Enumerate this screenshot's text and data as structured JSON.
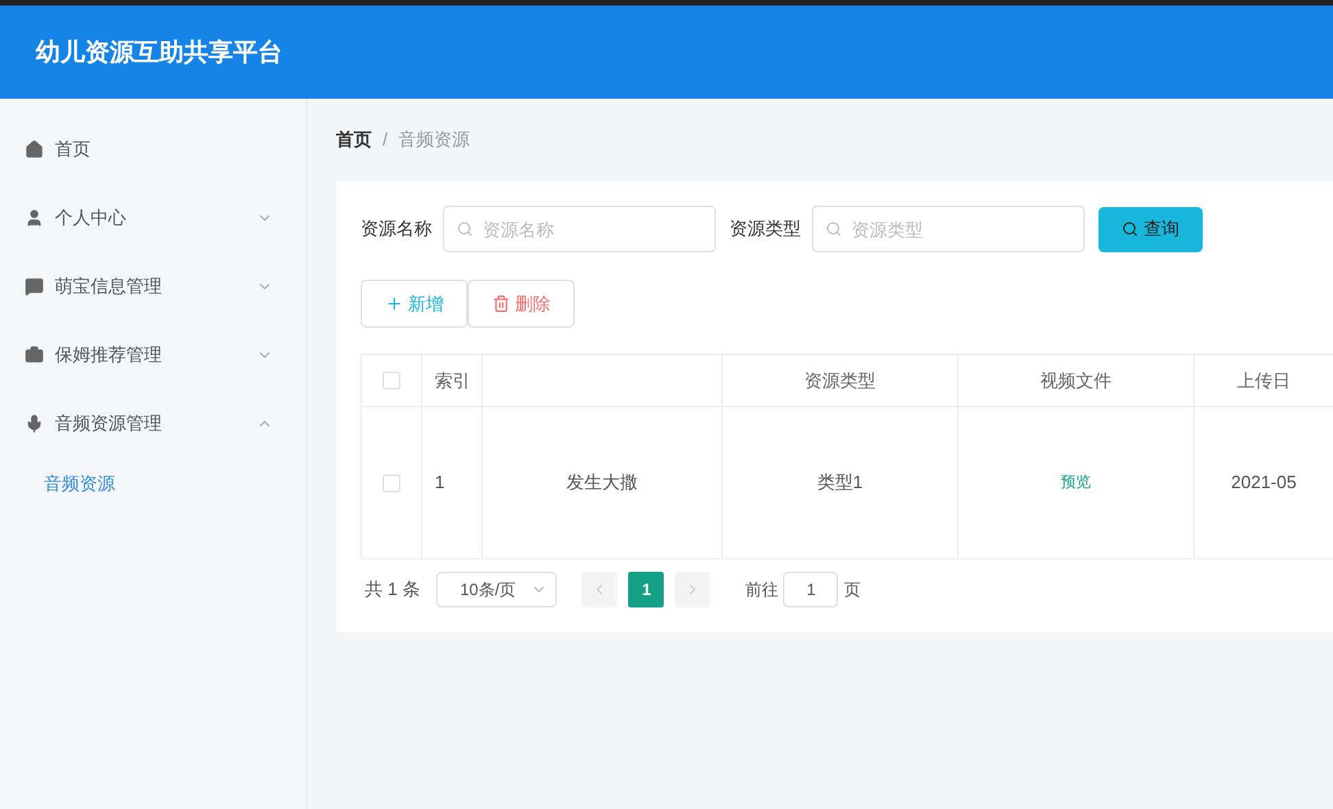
{
  "header": {
    "title": "幼儿资源互助共享平台"
  },
  "sidebar": {
    "items": [
      {
        "label": "首页"
      },
      {
        "label": "个人中心",
        "expanded": false
      },
      {
        "label": "萌宝信息管理",
        "expanded": false
      },
      {
        "label": "保姆推荐管理",
        "expanded": false
      },
      {
        "label": "音频资源管理",
        "expanded": true,
        "children": [
          {
            "label": "音频资源",
            "selected": true
          }
        ]
      }
    ]
  },
  "breadcrumb": [
    {
      "label": "首页"
    },
    {
      "label": "音频资源"
    }
  ],
  "breadcrumb_separator": "/",
  "search": {
    "fields": [
      {
        "label": "资源名称",
        "placeholder": "资源名称"
      },
      {
        "label": "资源类型",
        "placeholder": "资源类型"
      }
    ],
    "button": "查询"
  },
  "actions": [
    {
      "label": "新增",
      "kind": "add"
    },
    {
      "label": "删除",
      "kind": "delete"
    }
  ],
  "table": {
    "columns": [
      {
        "kind": "check",
        "checked": false
      },
      {
        "label": "索引"
      },
      {},
      {
        "label": "资源类型"
      },
      {
        "label": "视频文件"
      },
      {
        "label": "上传日"
      }
    ],
    "rows": [
      {
        "checked": false,
        "cells": [
          "",
          "1",
          "发生大撒",
          "类型1",
          "预览",
          "2021-05"
        ]
      }
    ]
  },
  "pagination": {
    "total": "共 1 条",
    "page_size": "10条/页",
    "pages": [
      {
        "label": "1",
        "selected": true
      }
    ],
    "goto_label": "前往",
    "goto_value": "1",
    "goto_suffix": "页"
  }
}
